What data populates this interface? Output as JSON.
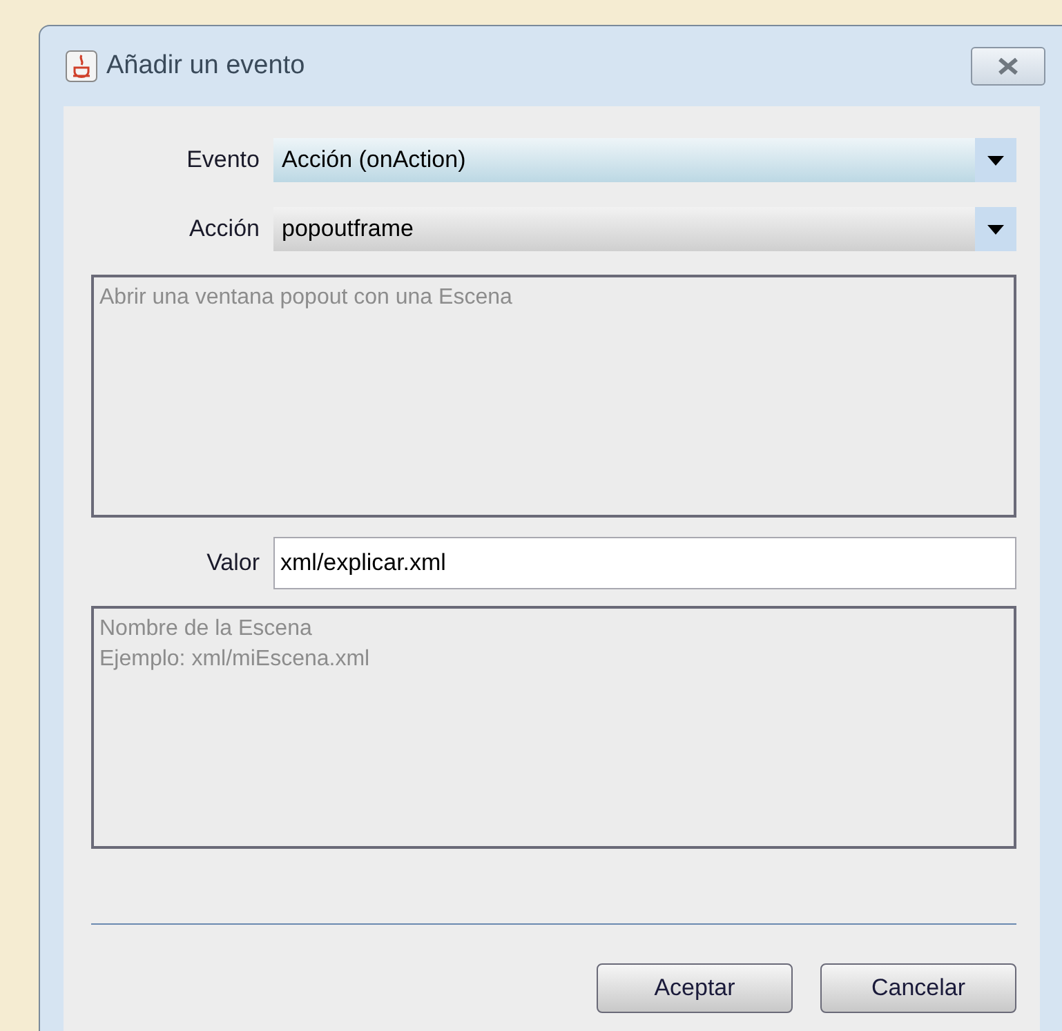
{
  "window": {
    "title": "Añadir un evento"
  },
  "fields": [
    {
      "kind": "combo",
      "label": "Evento",
      "value": "Acción (onAction)",
      "focused": true
    },
    {
      "kind": "combo",
      "label": "Acción",
      "value": "popoutframe",
      "focused": false
    },
    {
      "kind": "description",
      "lines": [
        "Abrir una ventana popout con una Escena"
      ]
    },
    {
      "kind": "text",
      "label": "Valor",
      "value": "xml/explicar.xml"
    },
    {
      "kind": "description",
      "lines": [
        "Nombre de la Escena",
        "Ejemplo: xml/miEscena.xml"
      ]
    }
  ],
  "buttons": [
    "Aceptar",
    "Cancelar"
  ]
}
